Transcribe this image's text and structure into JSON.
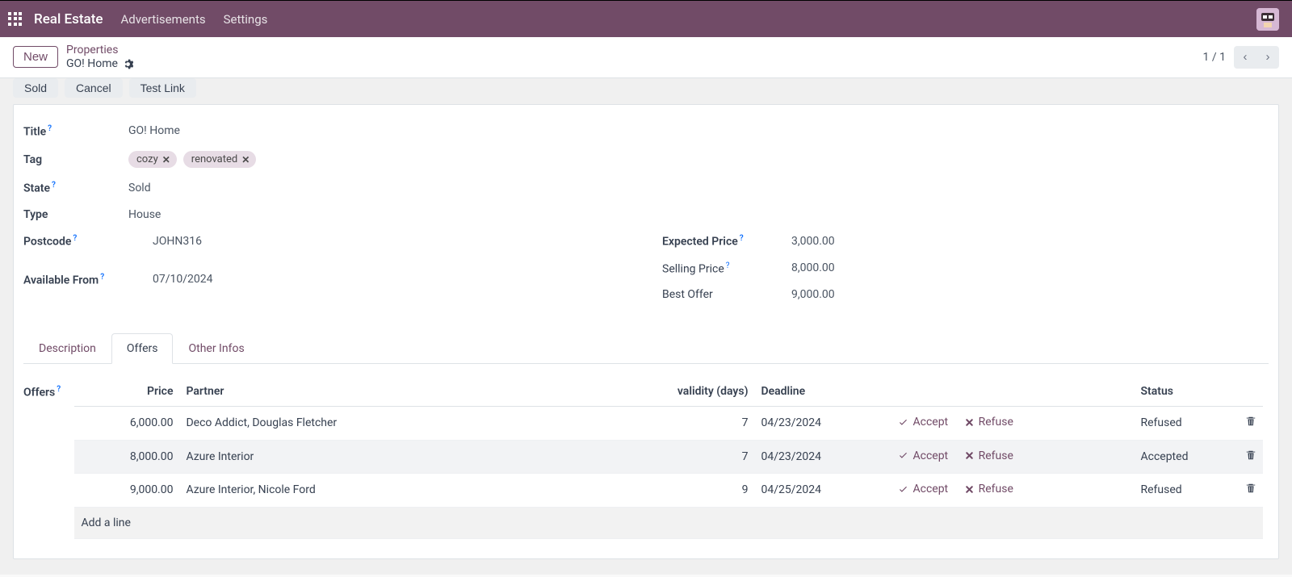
{
  "navbar": {
    "brand": "Real Estate",
    "links": [
      "Advertisements",
      "Settings"
    ]
  },
  "control": {
    "new_label": "New",
    "breadcrumb_root": "Properties",
    "breadcrumb_current": "GO! Home",
    "pager": "1 / 1"
  },
  "status_buttons": {
    "sold": "Sold",
    "cancel": "Cancel",
    "test_link": "Test Link"
  },
  "form": {
    "title_label": "Title",
    "title_value": "GO! Home",
    "tag_label": "Tag",
    "tags": [
      "cozy",
      "renovated"
    ],
    "state_label": "State",
    "state_value": "Sold",
    "type_label": "Type",
    "type_value": "House",
    "postcode_label": "Postcode",
    "postcode_value": "JOHN316",
    "available_label": "Available From",
    "available_value": "07/10/2024",
    "expected_price_label": "Expected Price",
    "expected_price_value": "3,000.00",
    "selling_price_label": "Selling Price",
    "selling_price_value": "8,000.00",
    "best_offer_label": "Best Offer",
    "best_offer_value": "9,000.00"
  },
  "tabs": {
    "description": "Description",
    "offers": "Offers",
    "other_infos": "Other Infos"
  },
  "offers_section": {
    "label": "Offers",
    "headers": {
      "price": "Price",
      "partner": "Partner",
      "validity": "validity (days)",
      "deadline": "Deadline",
      "status": "Status"
    },
    "actions": {
      "accept": "Accept",
      "refuse": "Refuse"
    },
    "rows": [
      {
        "price": "6,000.00",
        "partner": "Deco Addict, Douglas Fletcher",
        "validity": "7",
        "deadline": "04/23/2024",
        "status": "Refused"
      },
      {
        "price": "8,000.00",
        "partner": "Azure Interior",
        "validity": "7",
        "deadline": "04/23/2024",
        "status": "Accepted"
      },
      {
        "price": "9,000.00",
        "partner": "Azure Interior, Nicole Ford",
        "validity": "9",
        "deadline": "04/25/2024",
        "status": "Refused"
      }
    ],
    "add_line": "Add a line"
  }
}
